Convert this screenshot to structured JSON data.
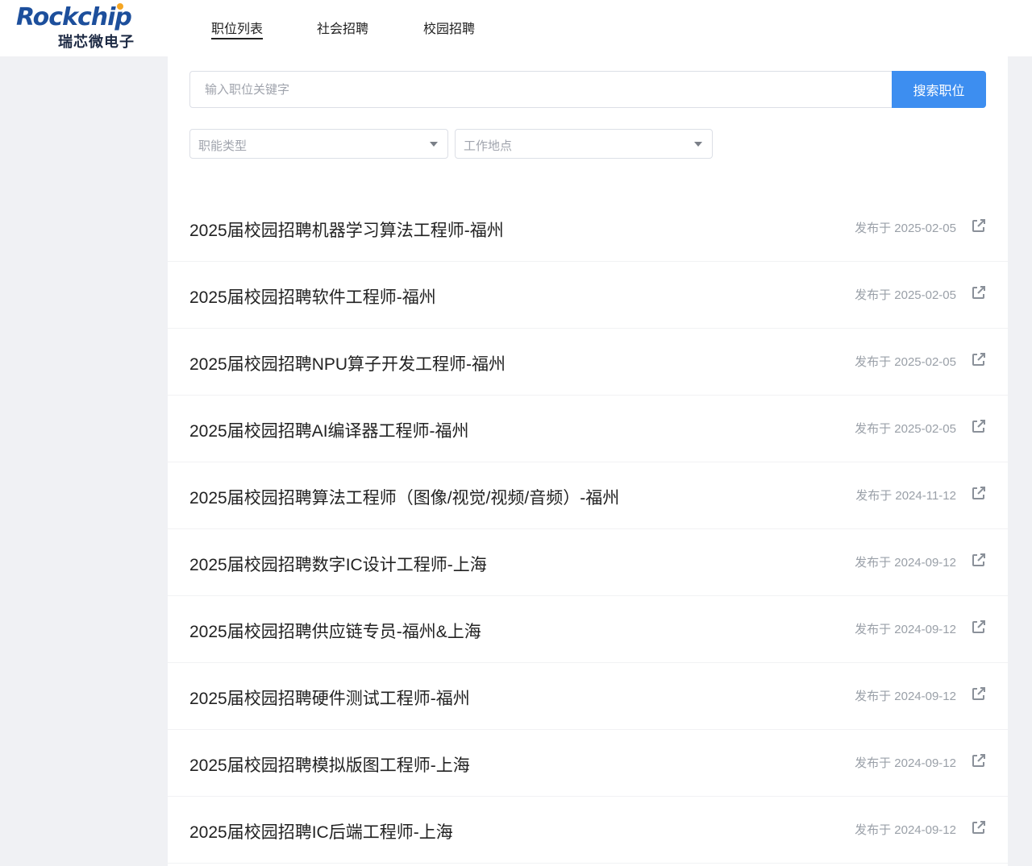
{
  "brand": {
    "logo_text": "Rockchip",
    "logo_cn": "瑞芯微电子"
  },
  "nav": {
    "items": [
      {
        "label": "职位列表",
        "active": true
      },
      {
        "label": "社会招聘",
        "active": false
      },
      {
        "label": "校园招聘",
        "active": false
      }
    ]
  },
  "search": {
    "placeholder": "输入职位关键字",
    "value": "",
    "button_label": "搜索职位"
  },
  "filters": {
    "category": {
      "placeholder": "职能类型"
    },
    "location": {
      "placeholder": "工作地点"
    }
  },
  "jobs": [
    {
      "title": "2025届校园招聘机器学习算法工程师-福州",
      "date": "发布于 2025-02-05"
    },
    {
      "title": "2025届校园招聘软件工程师-福州",
      "date": "发布于 2025-02-05"
    },
    {
      "title": "2025届校园招聘NPU算子开发工程师-福州",
      "date": "发布于 2025-02-05"
    },
    {
      "title": "2025届校园招聘AI编译器工程师-福州",
      "date": "发布于 2025-02-05"
    },
    {
      "title": "2025届校园招聘算法工程师（图像/视觉/视频/音频）-福州",
      "date": "发布于 2024-11-12"
    },
    {
      "title": "2025届校园招聘数字IC设计工程师-上海",
      "date": "发布于 2024-09-12"
    },
    {
      "title": "2025届校园招聘供应链专员-福州&上海",
      "date": "发布于 2024-09-12"
    },
    {
      "title": "2025届校园招聘硬件测试工程师-福州",
      "date": "发布于 2024-09-12"
    },
    {
      "title": "2025届校园招聘模拟版图工程师-上海",
      "date": "发布于 2024-09-12"
    },
    {
      "title": "2025届校园招聘IC后端工程师-上海",
      "date": "发布于 2024-09-12"
    }
  ],
  "colors": {
    "accent": "#3d8ef0",
    "brand": "#1d4f9c",
    "brand_dot": "#f5a623",
    "background": "#f0f1f4"
  },
  "icons": {
    "share": "share-icon",
    "dropdown": "chevron-down-icon"
  }
}
